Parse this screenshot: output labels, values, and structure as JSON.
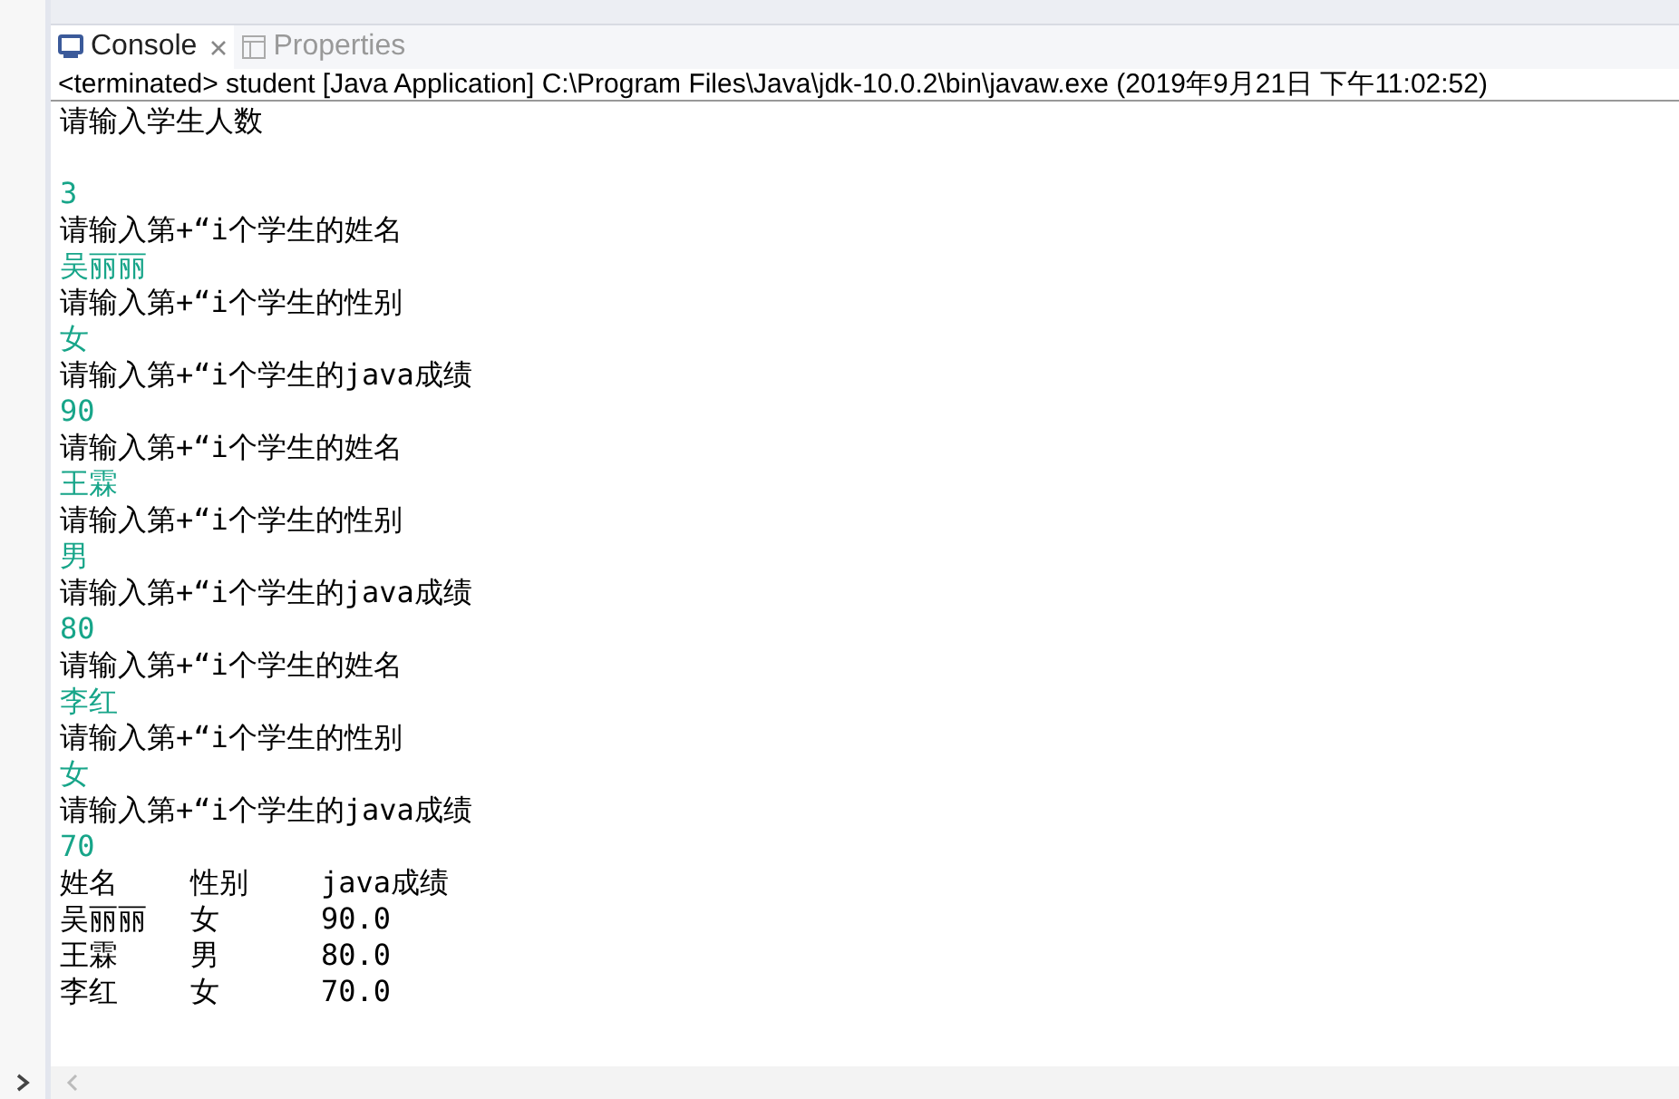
{
  "tabs": [
    {
      "label": "Console",
      "selected": true,
      "closable": true
    },
    {
      "label": "Properties",
      "selected": false,
      "closable": false
    }
  ],
  "status_line": "<terminated> student [Java Application] C:\\Program Files\\Java\\jdk-10.0.2\\bin\\javaw.exe (2019年9月21日 下午11:02:52)",
  "console_lines": [
    {
      "kind": "output",
      "text": "请输入学生人数"
    },
    {
      "kind": "blank"
    },
    {
      "kind": "input",
      "text": "3"
    },
    {
      "kind": "output",
      "text": "请输入第+“i个学生的姓名"
    },
    {
      "kind": "input",
      "text": "吴丽丽"
    },
    {
      "kind": "output",
      "text": "请输入第+“i个学生的性别"
    },
    {
      "kind": "input",
      "text": "女"
    },
    {
      "kind": "output",
      "text": "请输入第+“i个学生的java成绩"
    },
    {
      "kind": "input",
      "text": "90"
    },
    {
      "kind": "output",
      "text": "请输入第+“i个学生的姓名"
    },
    {
      "kind": "input",
      "text": "王霖"
    },
    {
      "kind": "output",
      "text": "请输入第+“i个学生的性别"
    },
    {
      "kind": "input",
      "text": "男"
    },
    {
      "kind": "output",
      "text": "请输入第+“i个学生的java成绩"
    },
    {
      "kind": "input",
      "text": "80"
    },
    {
      "kind": "output",
      "text": "请输入第+“i个学生的姓名"
    },
    {
      "kind": "input",
      "text": "李红"
    },
    {
      "kind": "output",
      "text": "请输入第+“i个学生的性别"
    },
    {
      "kind": "input",
      "text": "女"
    },
    {
      "kind": "output",
      "text": "请输入第+“i个学生的java成绩"
    },
    {
      "kind": "input",
      "text": "70"
    },
    {
      "kind": "table",
      "cells": [
        "姓名",
        "性别",
        "java成绩"
      ]
    },
    {
      "kind": "table",
      "cells": [
        "吴丽丽",
        "女",
        "90.0"
      ]
    },
    {
      "kind": "table",
      "cells": [
        "王霖",
        "男",
        "80.0"
      ]
    },
    {
      "kind": "table",
      "cells": [
        "李红",
        "女",
        "70.0"
      ]
    }
  ]
}
